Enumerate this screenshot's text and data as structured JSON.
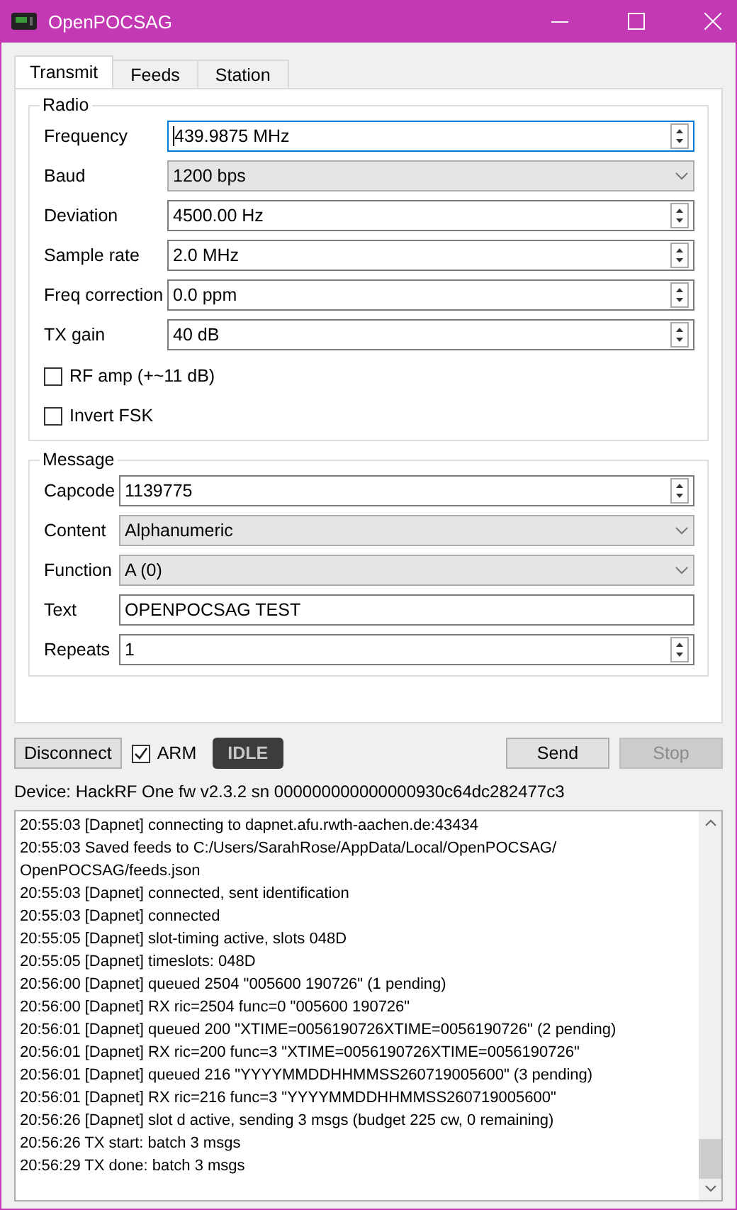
{
  "window": {
    "title": "OpenPOCSAG"
  },
  "tabs": [
    {
      "label": "Transmit",
      "selected": true
    },
    {
      "label": "Feeds",
      "selected": false
    },
    {
      "label": "Station",
      "selected": false
    }
  ],
  "radio": {
    "title": "Radio",
    "fields": [
      {
        "label": "Frequency",
        "kind": "spin",
        "value": "439.9875 MHz",
        "focused": true
      },
      {
        "label": "Baud",
        "kind": "combo",
        "value": "1200 bps"
      },
      {
        "label": "Deviation",
        "kind": "spin",
        "value": "4500.00 Hz",
        "focused": false
      },
      {
        "label": "Sample rate",
        "kind": "spin",
        "value": "2.0 MHz",
        "focused": false
      },
      {
        "label": "Freq correction",
        "kind": "spin",
        "value": "0.0 ppm",
        "focused": false
      },
      {
        "label": "TX gain",
        "kind": "spin",
        "value": "40 dB",
        "focused": false
      }
    ],
    "checks": [
      {
        "label": "RF amp (+~11 dB)",
        "checked": false
      },
      {
        "label": "Invert FSK",
        "checked": false
      }
    ]
  },
  "message": {
    "title": "Message",
    "fields": [
      {
        "label": "Capcode",
        "kind": "spin",
        "value": "1139775",
        "focused": false
      },
      {
        "label": "Content",
        "kind": "combo",
        "value": "Alphanumeric"
      },
      {
        "label": "Function",
        "kind": "combo",
        "value": "A (0)"
      },
      {
        "label": "Text",
        "kind": "text",
        "value": "OPENPOCSAG TEST",
        "focused": false
      },
      {
        "label": "Repeats",
        "kind": "spin",
        "value": "1",
        "focused": false
      }
    ]
  },
  "controls": {
    "disconnect": "Disconnect",
    "arm": {
      "label": "ARM",
      "checked": true
    },
    "status": "IDLE",
    "send": {
      "label": "Send",
      "disabled": false
    },
    "stop": {
      "label": "Stop",
      "disabled": true
    }
  },
  "device": "Device: HackRF One  fw v2.3.2  sn 000000000000000930c64dc282477c3",
  "log": [
    "20:55:03 [Dapnet] connecting to dapnet.afu.rwth-aachen.de:43434",
    "20:55:03 Saved feeds to C:/Users/SarahRose/AppData/Local/OpenPOCSAG/OpenPOCSAG/feeds.json",
    "20:55:03 [Dapnet] connected, sent identification",
    "20:55:03 [Dapnet] connected",
    "20:55:05 [Dapnet] slot-timing active, slots 048D",
    "20:55:05 [Dapnet] timeslots: 048D",
    "20:56:00 [Dapnet] queued 2504 \"005600   190726\" (1 pending)",
    "20:56:00 [Dapnet] RX ric=2504 func=0 \"005600   190726\"",
    "20:56:01 [Dapnet] queued 200 \"XTIME=0056190726XTIME=0056190726\" (2 pending)",
    "20:56:01 [Dapnet] RX ric=200 func=3 \"XTIME=0056190726XTIME=0056190726\"",
    "20:56:01 [Dapnet] queued 216 \"YYYYMMDDHHMMSS260719005600\" (3 pending)",
    "20:56:01 [Dapnet] RX ric=216 func=3 \"YYYYMMDDHHMMSS260719005600\"",
    "20:56:26 [Dapnet] slot d active, sending 3 msgs (budget 225 cw, 0 remaining)",
    "20:56:26 TX start: batch 3 msgs",
    "20:56:29 TX done: batch 3 msgs"
  ]
}
